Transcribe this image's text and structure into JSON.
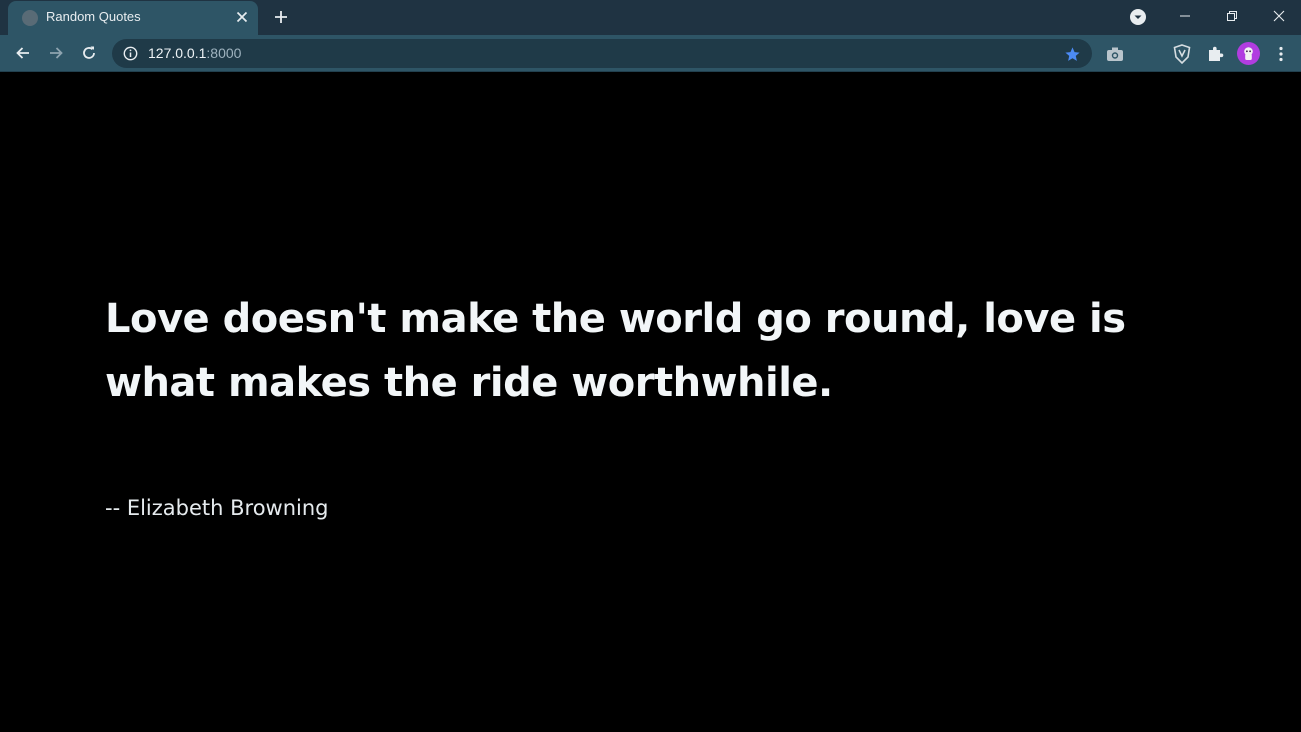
{
  "browser": {
    "tab": {
      "title": "Random Quotes"
    },
    "address": {
      "host": "127.0.0.1",
      "port": ":8000"
    },
    "icons": {
      "back": "arrow-left-icon",
      "forward": "arrow-right-icon",
      "reload": "reload-icon",
      "info": "info-icon",
      "bookmark": "star-icon",
      "screenshot": "camera-icon",
      "brave": "shield-icon",
      "extensions": "puzzle-icon",
      "menu": "kebab-menu-icon"
    },
    "colors": {
      "tabstrip": "#1f3342",
      "toolbar": "#2e5566",
      "accent_star": "#4c8bf5",
      "avatar": "#b13de0"
    }
  },
  "page": {
    "quote": "Love doesn't make the world go round, love is what makes the ride worthwhile.",
    "author": "-- Elizabeth Browning",
    "background": "#000000"
  }
}
